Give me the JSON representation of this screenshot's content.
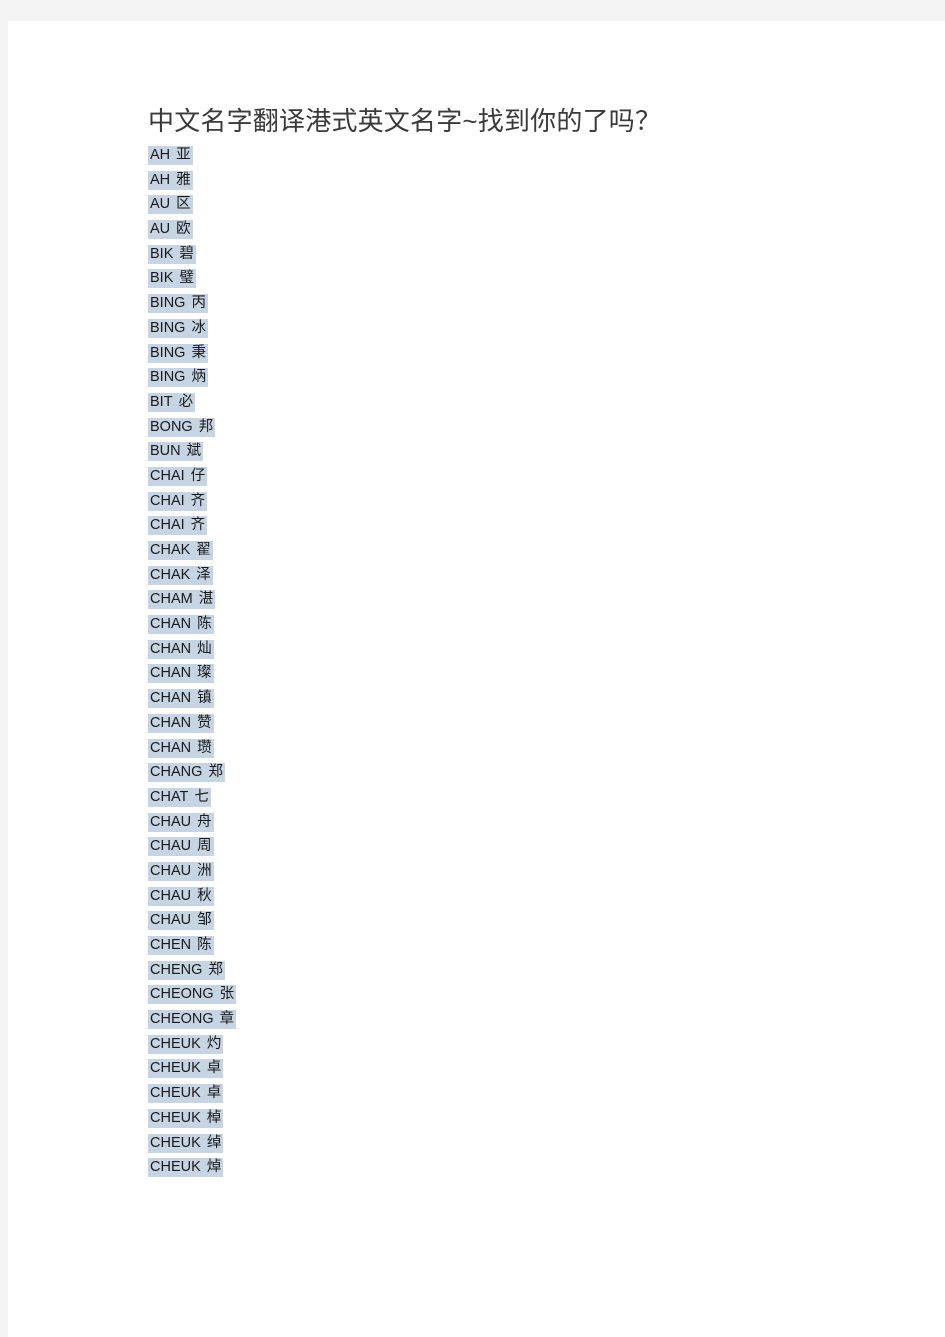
{
  "document": {
    "title": "中文名字翻译港式英文名字~找到你的了吗？",
    "background_color": "#f4f4f4",
    "page_color": "#ffffff",
    "highlight_color": "#c6d4e3",
    "text_color": "#1a1a1a",
    "title_color": "#3a3a3a"
  },
  "names": [
    {
      "romanization": "AH",
      "hanzi": "亚"
    },
    {
      "romanization": "AH",
      "hanzi": "雅"
    },
    {
      "romanization": "AU",
      "hanzi": "区"
    },
    {
      "romanization": "AU",
      "hanzi": "欧"
    },
    {
      "romanization": "BIK",
      "hanzi": "碧"
    },
    {
      "romanization": "BIK",
      "hanzi": "璧"
    },
    {
      "romanization": "BING",
      "hanzi": "丙"
    },
    {
      "romanization": "BING",
      "hanzi": "冰"
    },
    {
      "romanization": "BING",
      "hanzi": "秉"
    },
    {
      "romanization": "BING",
      "hanzi": "炳"
    },
    {
      "romanization": "BIT",
      "hanzi": "必"
    },
    {
      "romanization": "BONG",
      "hanzi": "邦"
    },
    {
      "romanization": "BUN",
      "hanzi": "斌"
    },
    {
      "romanization": "CHAI",
      "hanzi": "仔"
    },
    {
      "romanization": "CHAI",
      "hanzi": "齐"
    },
    {
      "romanization": "CHAI",
      "hanzi": "齐"
    },
    {
      "romanization": "CHAK",
      "hanzi": "翟"
    },
    {
      "romanization": "CHAK",
      "hanzi": "泽"
    },
    {
      "romanization": "CHAM",
      "hanzi": "湛"
    },
    {
      "romanization": "CHAN",
      "hanzi": "陈"
    },
    {
      "romanization": "CHAN",
      "hanzi": "灿"
    },
    {
      "romanization": "CHAN",
      "hanzi": "璨"
    },
    {
      "romanization": "CHAN",
      "hanzi": "镇"
    },
    {
      "romanization": "CHAN",
      "hanzi": "赞"
    },
    {
      "romanization": "CHAN",
      "hanzi": "瓒"
    },
    {
      "romanization": "CHANG",
      "hanzi": "郑"
    },
    {
      "romanization": "CHAT",
      "hanzi": "七"
    },
    {
      "romanization": "CHAU",
      "hanzi": "舟"
    },
    {
      "romanization": "CHAU",
      "hanzi": "周"
    },
    {
      "romanization": "CHAU",
      "hanzi": "洲"
    },
    {
      "romanization": "CHAU",
      "hanzi": "秋"
    },
    {
      "romanization": "CHAU",
      "hanzi": "邹"
    },
    {
      "romanization": "CHEN",
      "hanzi": "陈"
    },
    {
      "romanization": "CHENG",
      "hanzi": "郑"
    },
    {
      "romanization": "CHEONG",
      "hanzi": "张"
    },
    {
      "romanization": "CHEONG",
      "hanzi": "章"
    },
    {
      "romanization": "CHEUK",
      "hanzi": "灼"
    },
    {
      "romanization": "CHEUK",
      "hanzi": "卓"
    },
    {
      "romanization": "CHEUK",
      "hanzi": "卓"
    },
    {
      "romanization": "CHEUK",
      "hanzi": "棹"
    },
    {
      "romanization": "CHEUK",
      "hanzi": "绰"
    },
    {
      "romanization": "CHEUK",
      "hanzi": "焯"
    }
  ]
}
